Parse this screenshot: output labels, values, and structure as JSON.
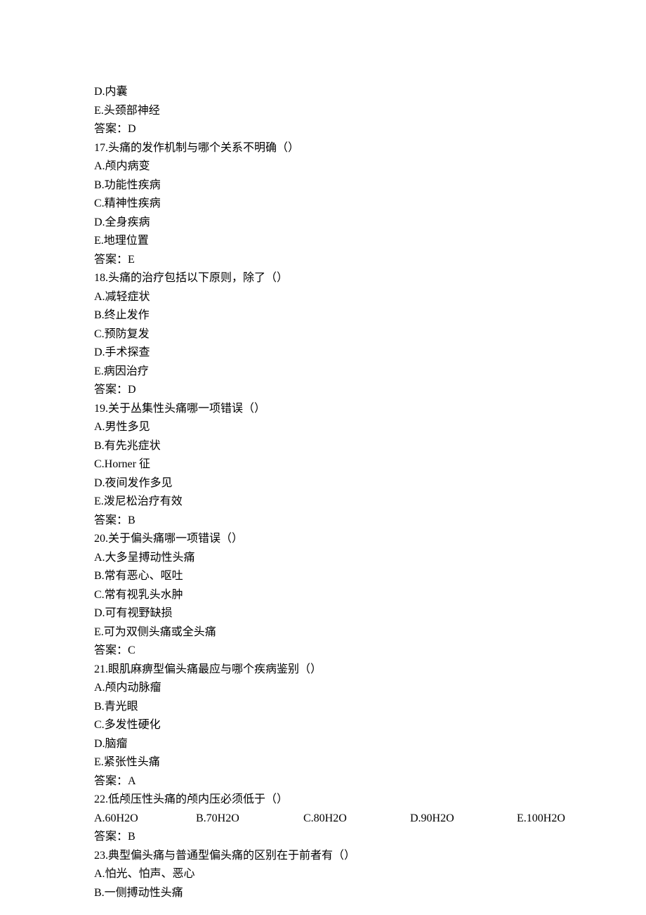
{
  "q16": {
    "optD": "D.内囊",
    "optE": "E.头颈部神经",
    "answer": "答案：D"
  },
  "q17": {
    "stem": "17.头痛的发作机制与哪个关系不明确（）",
    "optA": "A.颅内病变",
    "optB": "B.功能性疾病",
    "optC": "C.精神性疾病",
    "optD": "D.全身疾病",
    "optE": "E.地理位置",
    "answer": "答案：E"
  },
  "q18": {
    "stem": "18.头痛的治疗包括以下原则，除了（）",
    "optA": "A.减轻症状",
    "optB": "B.终止发作",
    "optC": "C.预防复发",
    "optD": "D.手术探查",
    "optE": "E.病因治疗",
    "answer": "答案：D"
  },
  "q19": {
    "stem": "19.关于丛集性头痛哪一项错误（）",
    "optA": "A.男性多见",
    "optB": "B.有先兆症状",
    "optC": "C.Horner 征",
    "optD": "D.夜间发作多见",
    "optE": "E.泼尼松治疗有效",
    "answer": "答案：B"
  },
  "q20": {
    "stem": "20.关于偏头痛哪一项错误（）",
    "optA": "A.大多呈搏动性头痛",
    "optB": "B.常有恶心、呕吐",
    "optC": "C.常有视乳头水肿",
    "optD": "D.可有视野缺损",
    "optE": "E.可为双侧头痛或全头痛",
    "answer": "答案：C"
  },
  "q21": {
    "stem": "21.眼肌麻痹型偏头痛最应与哪个疾病鉴别（）",
    "optA": "A.颅内动脉瘤",
    "optB": "B.青光眼",
    "optC": "C.多发性硬化",
    "optD": "D.脑瘤",
    "optE": "E.紧张性头痛",
    "answer": "答案：A"
  },
  "q22": {
    "stem": "22.低颅压性头痛的颅内压必须低于（）",
    "optA": "A.60H2O",
    "optB": "B.70H2O",
    "optC": "C.80H2O",
    "optD": "D.90H2O",
    "optE": "E.100H2O",
    "answer": "答案：B"
  },
  "q23": {
    "stem": "23.典型偏头痛与普通型偏头痛的区别在于前者有（）",
    "optA": "A.怕光、怕声、恶心",
    "optB": "B.一侧搏动性头痛"
  }
}
